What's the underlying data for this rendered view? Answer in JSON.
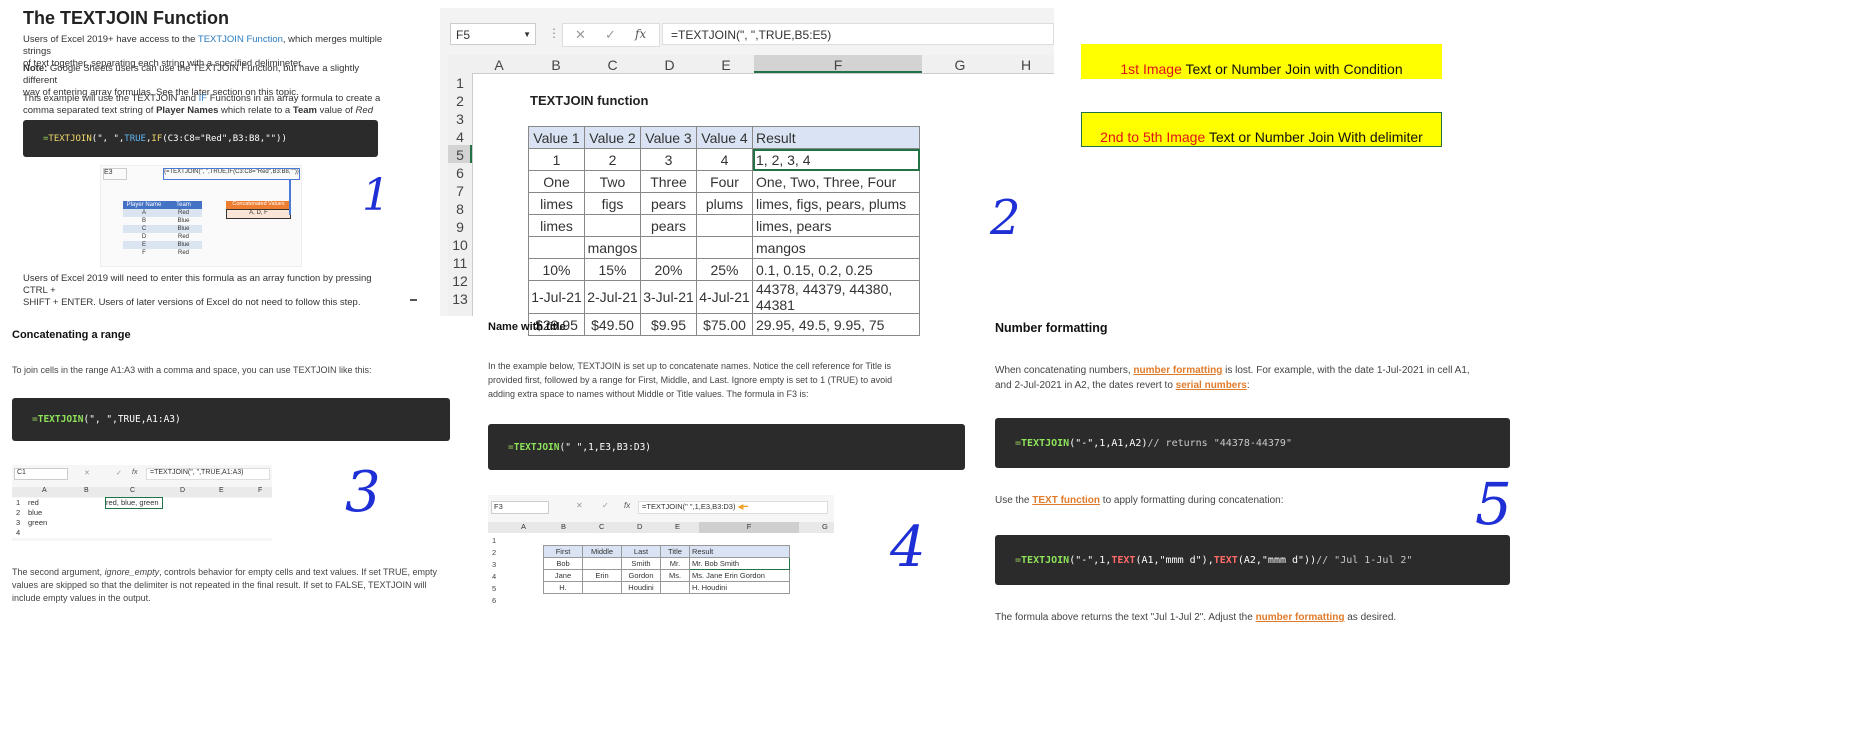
{
  "panel1": {
    "title": "The TEXTJOIN Function",
    "p1_a": "Users of Excel 2019+ have access to the ",
    "p1_link": "TEXTJOIN Function",
    "p1_b": ", which merges multiple strings",
    "p1_c": "of text together, separating each string with a specified delimineter.",
    "note_label": "Note:",
    "note_a": " Google Sheets users can use the TEXTJOIN Function, but have a slightly different",
    "note_b": "way of entering array formulas. See the later section on this topic.",
    "p3_a": "This example will use the TEXTJOIN and ",
    "p3_if": "IF",
    "p3_b": " Functions in an array formula to create a",
    "p3_c": "comma separated text string of ",
    "p3_bold1": "Player Names",
    "p3_d": " which relate to a ",
    "p3_bold2": "Team",
    "p3_e": " value of ",
    "p3_it": "Red",
    "code_eq": "=",
    "code_fn": "TEXTJOIN",
    "code_a": "(\", \",",
    "code_true": "TRUE",
    "code_b": ",",
    "code_if": "IF",
    "code_c": "(C3:C8=\"Red\",B3:B8,\"\"))",
    "mini_cell": "E3",
    "mini_formula": "{=TEXTJOIN(\", \",TRUE,IF(C3:C8=\"Red\",B3:B8,\"\"))}",
    "mini_cols": [
      "A",
      "B",
      "C",
      "D",
      "E"
    ],
    "mini_headers": [
      "Player Name",
      "Team"
    ],
    "mini_rows": [
      [
        "A",
        "Red"
      ],
      [
        "B",
        "Blue"
      ],
      [
        "C",
        "Blue"
      ],
      [
        "D",
        "Red"
      ],
      [
        "E",
        "Blue"
      ],
      [
        "F",
        "Red"
      ]
    ],
    "mini_concat_header": "Concatenated Values",
    "mini_concat_value": "A, D, F",
    "p4_a": "Users of Excel 2019 will need to enter this formula as an array function by pressing CTRL +",
    "p4_b": "SHIFT + ENTER. Users of later versions of Excel do not need to follow this step.",
    "hand": "1"
  },
  "panel2": {
    "name_box": "F5",
    "formula": "=TEXTJOIN(\", \",TRUE,B5:E5)",
    "cancel": "✕",
    "enter": "✓",
    "fx": "fx",
    "cols": [
      "A",
      "B",
      "C",
      "D",
      "E",
      "F",
      "G",
      "H"
    ],
    "rows": [
      "1",
      "2",
      "3",
      "4",
      "5",
      "6",
      "7",
      "8",
      "9",
      "10",
      "11",
      "12",
      "13"
    ],
    "sheet_title": "TEXTJOIN function",
    "headers": [
      "Value 1",
      "Value 2",
      "Value 3",
      "Value 4",
      "Result"
    ],
    "data": [
      [
        "1",
        "2",
        "3",
        "4",
        "1, 2, 3, 4"
      ],
      [
        "One",
        "Two",
        "Three",
        "Four",
        "One, Two, Three, Four"
      ],
      [
        "limes",
        "figs",
        "pears",
        "plums",
        "limes, figs, pears, plums"
      ],
      [
        "limes",
        "",
        "pears",
        "",
        "limes, pears"
      ],
      [
        "",
        "mangos",
        "",
        "",
        "mangos"
      ],
      [
        "10%",
        "15%",
        "20%",
        "25%",
        "0.1, 0.15, 0.2, 0.25"
      ],
      [
        "1-Jul-21",
        "2-Jul-21",
        "3-Jul-21",
        "4-Jul-21",
        "44378, 44379, 44380, 44381"
      ],
      [
        "$29.95",
        "$49.50",
        "$9.95",
        "$75.00",
        "29.95, 49.5, 9.95, 75"
      ]
    ],
    "hand": "2"
  },
  "legend": {
    "l1_red": "1st Image",
    "l1_black": " Text or Number Join with Condition",
    "l2_red": "2nd to 5th Image",
    "l2_black": " Text or Number Join With delimiter",
    "red": "#e0121b",
    "yellow": "#ffff00"
  },
  "panel3": {
    "title": "Concatenating a range",
    "p1": "To join cells in the range A1:A3 with a comma and space, you can use TEXTJOIN like this:",
    "code_eq": "=",
    "code_fn": "TEXTJOIN",
    "code_rest": "(\", \",TRUE,A1:A3)",
    "mini_cell": "C1",
    "mini_formula": "=TEXTJOIN(\", \",TRUE,A1:A3)",
    "mini_cols": [
      "A",
      "B",
      "C",
      "D",
      "E",
      "F"
    ],
    "mini_rows": [
      [
        "1",
        "red",
        "",
        "red, blue, green"
      ],
      [
        "2",
        "blue",
        "",
        ""
      ],
      [
        "3",
        "green",
        "",
        ""
      ],
      [
        "4",
        "",
        "",
        ""
      ]
    ],
    "p2_a": "The second argument, ",
    "p2_it": "ignore_empty",
    "p2_b": ", controls behavior for empty cells and text values. If set TRUE, empty",
    "p2_c": "values are skipped so that the delimiter is not repeated in the final result. If set to FALSE, TEXTJOIN will",
    "p2_d": "include empty values in the output.",
    "hand": "3"
  },
  "panel4": {
    "title": "Name with title",
    "p1": "In the example below, TEXTJOIN is set up to concatenate names. Notice the cell reference for Title is",
    "p2": "provided first, followed by a range for First, Middle, and Last. Ignore empty is set to 1 (TRUE) to avoid",
    "p3": "adding extra space to names without Middle or Title values. The formula in F3 is:",
    "code_eq": "=",
    "code_fn": "TEXTJOIN",
    "code_rest": "(\" \",1,E3,B3:D3)",
    "mini_cell": "F3",
    "mini_formula": "=TEXTJOIN(\" \",1,E3,B3:D3)",
    "mini_cols": [
      "A",
      "B",
      "C",
      "D",
      "E",
      "F",
      "G"
    ],
    "mini_headers": [
      "First",
      "Middle",
      "Last",
      "Title",
      "Result"
    ],
    "mini_rows": [
      [
        "Bob",
        "",
        "Smith",
        "Mr.",
        "Mr. Bob Smith"
      ],
      [
        "Jane",
        "Erin",
        "Gordon",
        "Ms.",
        "Ms. Jane Erin Gordon"
      ],
      [
        "H.",
        "",
        "Houdini",
        "",
        "H. Houdini"
      ]
    ],
    "hand": "4"
  },
  "panel5": {
    "title": "Number formatting",
    "p1_a": "When concatenating numbers, ",
    "p1_link": "number formatting",
    "p1_b": " is lost. For example, with the date 1-Jul-2021 in cell A1,",
    "p1_c": "and 2-Jul-2021 in A2, the dates revert to ",
    "p1_link2": "serial numbers",
    "p1_d": ":",
    "code1_eq": "=",
    "code1_fn": "TEXTJOIN",
    "code1_rest": "(\"-\",1,A1,A2)",
    "code1_cm": " // returns \"44378-44379\"",
    "p2_a": "Use the ",
    "p2_link": "TEXT function",
    "p2_b": " to apply formatting during concatenation:",
    "code2_eq": "=",
    "code2_fn": "TEXTJOIN",
    "code2_a": "(\"-\",1,",
    "code2_t1": "TEXT",
    "code2_b": "(A1,\"mmm d\"),",
    "code2_t2": "TEXT",
    "code2_c": "(A2,\"mmm d\"))",
    "code2_cm": " // \"Jul 1-Jul 2\"",
    "p3_a": "The formula above returns the text \"Jul 1-Jul 2\".  Adjust the ",
    "p3_link": "number formatting",
    "p3_b": " as desired.",
    "hand": "5"
  }
}
